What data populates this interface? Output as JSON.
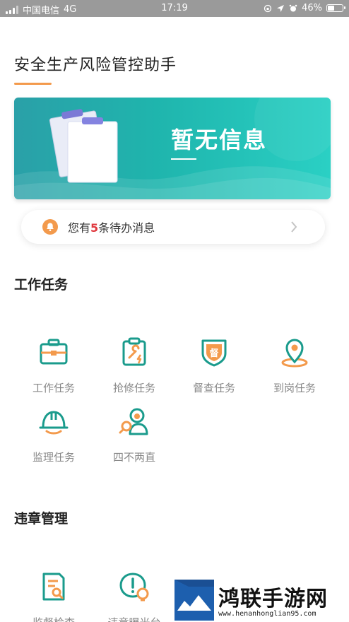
{
  "status_bar": {
    "carrier": "中国电信",
    "network": "4G",
    "time": "17:19",
    "battery": "46%",
    "battery_level": 0.46
  },
  "app": {
    "title": "安全生产风险管控助手",
    "accent_color": "#f39a4c",
    "teal_color": "#1a9b8c"
  },
  "banner": {
    "text": "暂无信息"
  },
  "notice": {
    "prefix": "您有",
    "count": "5",
    "suffix": "条待办消息",
    "icon": "bell-icon"
  },
  "work_tasks": {
    "title": "工作任务",
    "items": [
      {
        "label": "工作任务",
        "icon": "toolbox-icon"
      },
      {
        "label": "抢修任务",
        "icon": "repair-clipboard-icon"
      },
      {
        "label": "督查任务",
        "icon": "inspection-shield-icon"
      },
      {
        "label": "到岗任务",
        "icon": "location-pin-icon"
      },
      {
        "label": "监理任务",
        "icon": "hard-hat-icon"
      },
      {
        "label": "四不两直",
        "icon": "person-search-icon"
      }
    ]
  },
  "violations": {
    "title": "违章管理",
    "items": [
      {
        "label": "监督检查",
        "icon": "document-search-icon"
      },
      {
        "label": "违章曝光台",
        "icon": "warning-bulb-icon"
      }
    ]
  },
  "watermark": {
    "title": "鸿联手游网",
    "url": "www.henanhonglian95.com"
  }
}
